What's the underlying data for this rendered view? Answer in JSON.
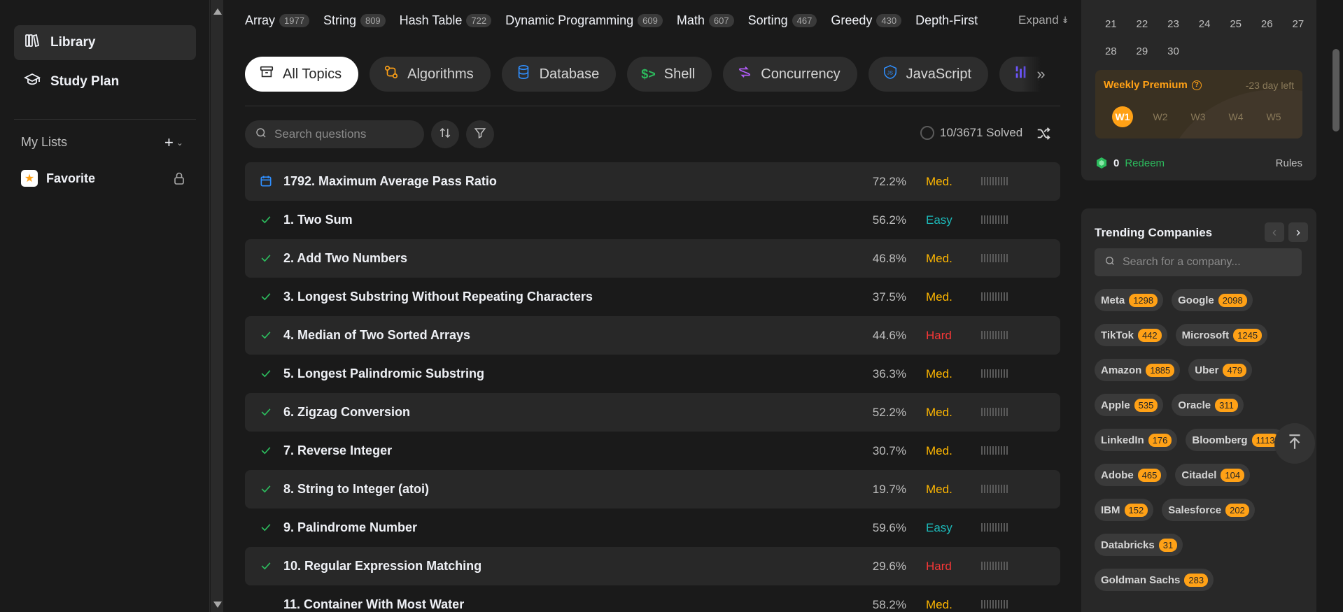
{
  "sidebar": {
    "nav": [
      {
        "label": "Library",
        "icon": "library-icon",
        "active": true
      },
      {
        "label": "Study Plan",
        "icon": "graduation-cap-icon",
        "active": false
      }
    ],
    "my_lists_title": "My Lists",
    "lists": [
      {
        "label": "Favorite",
        "icon": "star-icon"
      }
    ]
  },
  "tags": [
    {
      "label": "Array",
      "count": "1977"
    },
    {
      "label": "String",
      "count": "809"
    },
    {
      "label": "Hash Table",
      "count": "722"
    },
    {
      "label": "Dynamic Programming",
      "count": "609"
    },
    {
      "label": "Math",
      "count": "607"
    },
    {
      "label": "Sorting",
      "count": "467"
    },
    {
      "label": "Greedy",
      "count": "430"
    },
    {
      "label": "Depth-First",
      "count": ""
    }
  ],
  "expand_label": "Expand",
  "topics": [
    {
      "label": "All Topics",
      "icon": "inbox-icon",
      "active": true,
      "color": "#262626"
    },
    {
      "label": "Algorithms",
      "icon": "algorithm-icon",
      "color": "#ffa116"
    },
    {
      "label": "Database",
      "icon": "database-icon",
      "color": "#2f8fff"
    },
    {
      "label": "Shell",
      "icon": "terminal-icon",
      "color": "#2cbb5d"
    },
    {
      "label": "Concurrency",
      "icon": "concurrency-icon",
      "color": "#b65dff"
    },
    {
      "label": "JavaScript",
      "icon": "javascript-icon",
      "color": "#2f8fff"
    },
    {
      "label": "p",
      "icon": "pandas-icon",
      "color": "#6d55ff"
    }
  ],
  "search": {
    "placeholder": "Search questions"
  },
  "solved_status": "10/3671 Solved",
  "questions": [
    {
      "title": "1792. Maximum Average Pass Ratio",
      "rate": "72.2%",
      "difficulty": "Med.",
      "level": "med",
      "status": "daily"
    },
    {
      "title": "1. Two Sum",
      "rate": "56.2%",
      "difficulty": "Easy",
      "level": "easy",
      "status": "solved"
    },
    {
      "title": "2. Add Two Numbers",
      "rate": "46.8%",
      "difficulty": "Med.",
      "level": "med",
      "status": "solved"
    },
    {
      "title": "3. Longest Substring Without Repeating Characters",
      "rate": "37.5%",
      "difficulty": "Med.",
      "level": "med",
      "status": "solved"
    },
    {
      "title": "4. Median of Two Sorted Arrays",
      "rate": "44.6%",
      "difficulty": "Hard",
      "level": "hard",
      "status": "solved"
    },
    {
      "title": "5. Longest Palindromic Substring",
      "rate": "36.3%",
      "difficulty": "Med.",
      "level": "med",
      "status": "solved"
    },
    {
      "title": "6. Zigzag Conversion",
      "rate": "52.2%",
      "difficulty": "Med.",
      "level": "med",
      "status": "solved"
    },
    {
      "title": "7. Reverse Integer",
      "rate": "30.7%",
      "difficulty": "Med.",
      "level": "med",
      "status": "solved"
    },
    {
      "title": "8. String to Integer (atoi)",
      "rate": "19.7%",
      "difficulty": "Med.",
      "level": "med",
      "status": "solved"
    },
    {
      "title": "9. Palindrome Number",
      "rate": "59.6%",
      "difficulty": "Easy",
      "level": "easy",
      "status": "solved"
    },
    {
      "title": "10. Regular Expression Matching",
      "rate": "29.6%",
      "difficulty": "Hard",
      "level": "hard",
      "status": "solved"
    },
    {
      "title": "11. Container With Most Water",
      "rate": "58.2%",
      "difficulty": "Med.",
      "level": "med",
      "status": "none"
    }
  ],
  "calendar": {
    "rows": [
      [
        "21",
        "22",
        "23",
        "24",
        "25",
        "26",
        "27"
      ],
      [
        "28",
        "29",
        "30"
      ]
    ]
  },
  "premium": {
    "title": "Weekly Premium",
    "days_left": "-23 day left",
    "weeks": [
      "W1",
      "W2",
      "W3",
      "W4",
      "W5"
    ],
    "active_week": 0
  },
  "redeem": {
    "coins": "0",
    "link": "Redeem",
    "rules": "Rules"
  },
  "companies": {
    "title": "Trending Companies",
    "search_placeholder": "Search for a company...",
    "items": [
      {
        "name": "Meta",
        "count": "1298"
      },
      {
        "name": "Google",
        "count": "2098"
      },
      {
        "name": "TikTok",
        "count": "442"
      },
      {
        "name": "Microsoft",
        "count": "1245"
      },
      {
        "name": "Amazon",
        "count": "1885"
      },
      {
        "name": "Uber",
        "count": "479"
      },
      {
        "name": "Apple",
        "count": "535"
      },
      {
        "name": "Oracle",
        "count": "311"
      },
      {
        "name": "LinkedIn",
        "count": "176"
      },
      {
        "name": "Bloomberg",
        "count": "1113"
      },
      {
        "name": "Adobe",
        "count": "465"
      },
      {
        "name": "Citadel",
        "count": "104"
      },
      {
        "name": "IBM",
        "count": "152"
      },
      {
        "name": "Salesforce",
        "count": "202"
      },
      {
        "name": "Databricks",
        "count": "31"
      },
      {
        "name": "Goldman Sachs",
        "count": "283"
      }
    ]
  },
  "colors": {
    "accent": "#ffa116",
    "easy": "#1cbaba",
    "medium": "#ffb700",
    "hard": "#f63737",
    "solved": "#2cbb5d"
  }
}
